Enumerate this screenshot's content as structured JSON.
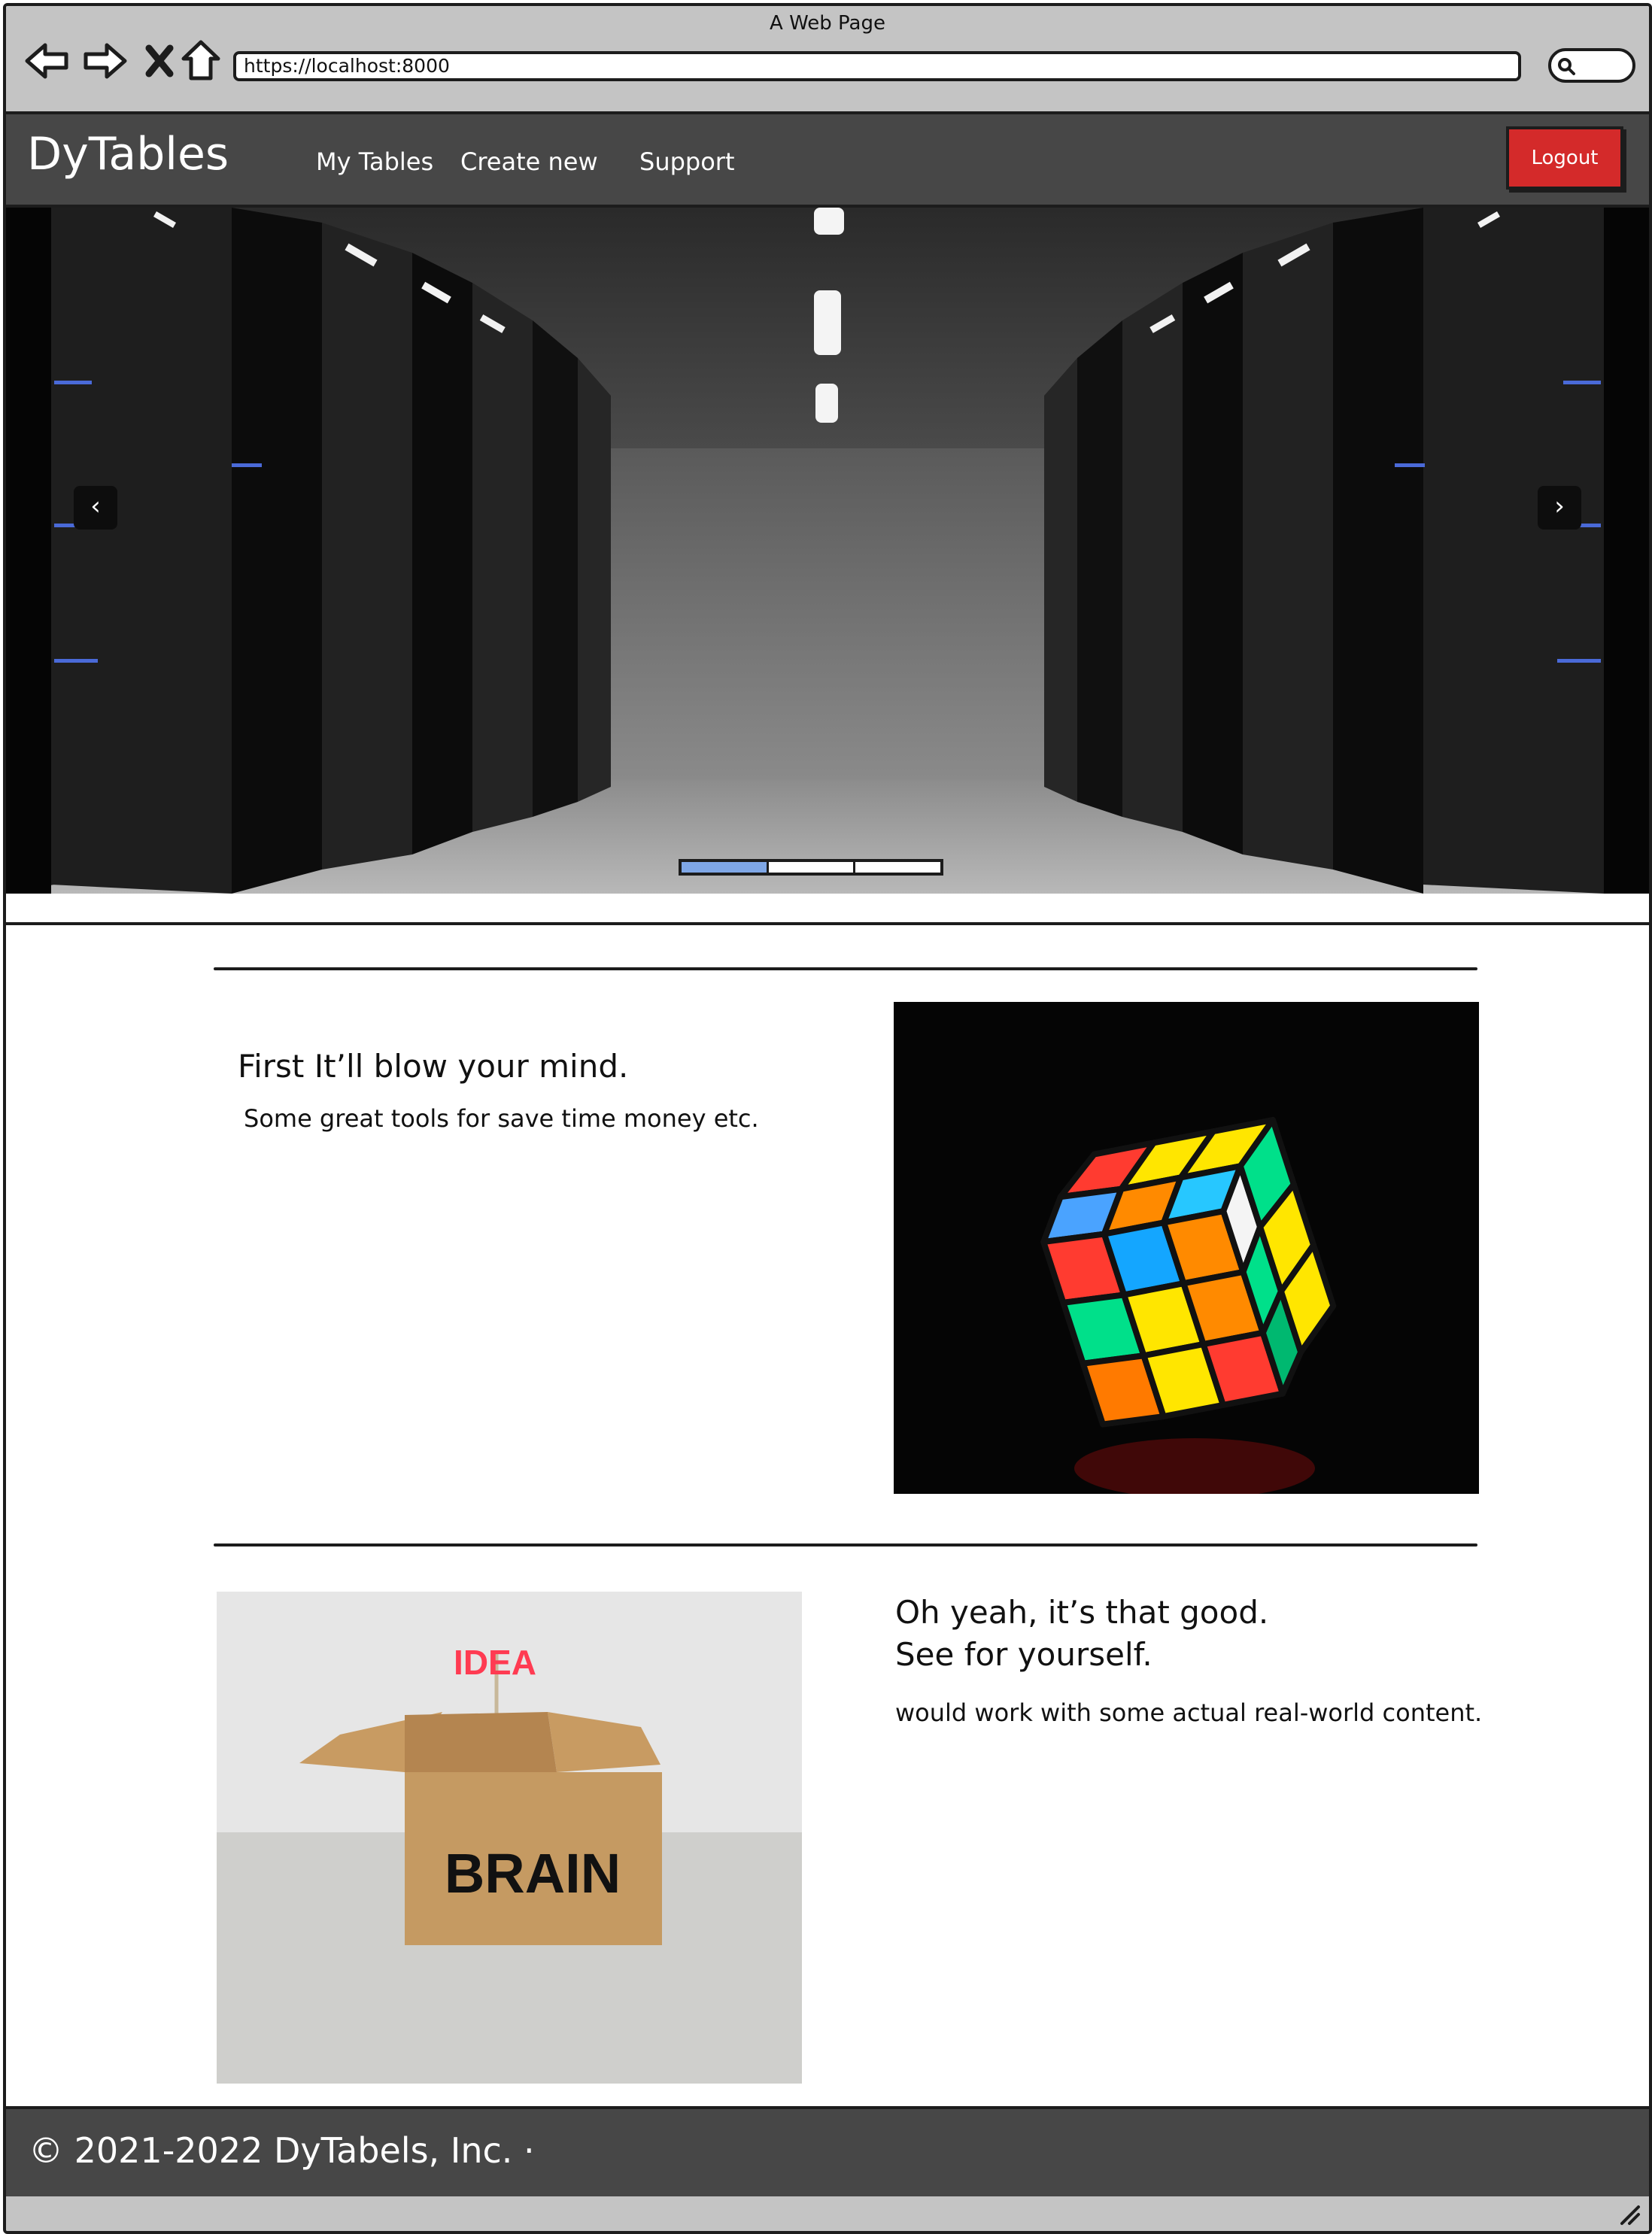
{
  "window": {
    "title": "A Web Page"
  },
  "browser": {
    "url": "https://localhost:8000",
    "icons": [
      "back-arrow-icon",
      "forward-arrow-icon",
      "close-x-icon",
      "home-icon",
      "search-icon"
    ]
  },
  "navbar": {
    "brand": "DyTables",
    "links": [
      "My Tables",
      "Create new",
      "Support"
    ],
    "logout_label": "Logout",
    "logout_color": "#d42a2a",
    "background": "#474747"
  },
  "carousel": {
    "prev_label": "‹",
    "next_label": "›",
    "slides": 3,
    "active_slide": 1,
    "indicator_active_color": "#7fa7e6"
  },
  "features": [
    {
      "heading": "First It’ll blow your mind.",
      "text": "Some great tools for save time money etc."
    },
    {
      "heading_line1": "Oh yeah, it’s that good.",
      "heading_line2": "See for yourself.",
      "text": "would work with some actual real-world content.",
      "image_sign": "IDEA",
      "image_box_label": "BRAIN"
    }
  ],
  "footer": {
    "copyright": "© 2021-2022 DyTabels, Inc. ·"
  }
}
